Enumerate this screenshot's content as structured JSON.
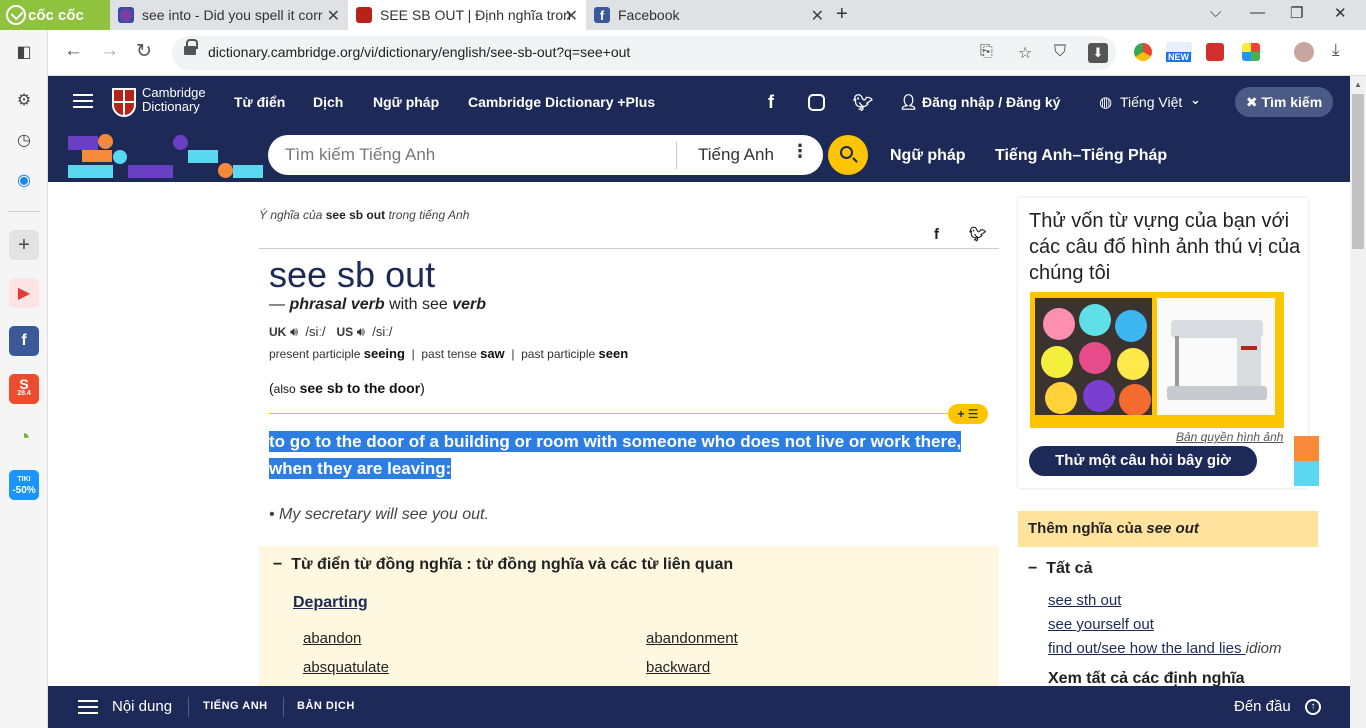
{
  "browser": {
    "brand": "cốc cốc",
    "tabs": [
      {
        "title": "see into - Did you spell it corr",
        "icon": "tab-favicon-1"
      },
      {
        "title": "SEE SB OUT | Định nghĩa trong",
        "icon": "cambridge-favicon"
      },
      {
        "title": "Facebook",
        "icon": "facebook-favicon"
      }
    ],
    "url": "dictionary.cambridge.org/vi/dictionary/english/see-sb-out?q=see+out",
    "extension_badge": "NEW"
  },
  "sidebar": {
    "tiki_label": "TIKI",
    "tiki_discount": "-50%",
    "shopee_label": "S",
    "shopee_date": "28.4"
  },
  "site": {
    "logo_line1": "Cambridge",
    "logo_line2": "Dictionary",
    "nav": [
      "Từ điển",
      "Dịch",
      "Ngữ pháp",
      "Cambridge Dictionary +Plus"
    ],
    "login": "Đăng nhập / Đăng ký",
    "language": "Tiếng Việt",
    "search_pill": "Tìm kiếm",
    "search_placeholder": "Tìm kiếm Tiếng Anh",
    "search_lang": "Tiếng Anh",
    "band_links": [
      "Ngữ pháp",
      "Tiếng Anh–Tiếng Pháp"
    ]
  },
  "entry": {
    "crumb_prefix": "Ý nghĩa của",
    "crumb_word": "see sb out",
    "crumb_suffix": "trong tiếng Anh",
    "headword": "see sb out",
    "pos_dash": "—",
    "pos": "phrasal verb",
    "pos_with": "with see",
    "pos_verb": "verb",
    "uk_label": "UK",
    "uk_ipa": "/siː/",
    "us_label": "US",
    "us_ipa": "/siː/",
    "inflections": [
      {
        "label": "present participle",
        "form": "seeing"
      },
      {
        "label": "past tense",
        "form": "saw"
      },
      {
        "label": "past participle",
        "form": "seen"
      }
    ],
    "also_label": "also",
    "also_form": "see sb to the door",
    "definition": "to go to the door of a building or room with someone who does not live or work there, when they are leaving:",
    "example": "My secretary will see you out.",
    "add_list": "+",
    "thesaurus_title": "Từ điển từ đồng nghĩa : từ đồng nghĩa và các từ liên quan",
    "thesaurus_group": "Departing",
    "thesaurus_col1": [
      "abandon",
      "absquatulate"
    ],
    "thesaurus_col2": [
      "abandonment",
      "backward"
    ]
  },
  "side": {
    "quiz_heading": "Thử vốn từ vựng của bạn với các câu đố hình ảnh thú vị của chúng tôi",
    "copyright": "Bản quyền hình ảnh",
    "quiz_button": "Thử một câu hỏi bây giờ",
    "more_prefix": "Thêm nghĩa của",
    "more_word": "see out",
    "all_label": "Tất cả",
    "links": [
      "see sth out",
      "see yourself out",
      "find out/see how the land lies"
    ],
    "idiom_label": "idiom",
    "see_all": "Xem tất cả các định nghĩa"
  },
  "bottom": {
    "contents": "Nội dung",
    "english": "TIẾNG ANH",
    "translation": "BẢN DỊCH",
    "to_top": "Đến đầu"
  },
  "colors": {
    "navy": "#1d2a57",
    "yellow": "#fec400",
    "highlight": "#2c7ee2"
  }
}
